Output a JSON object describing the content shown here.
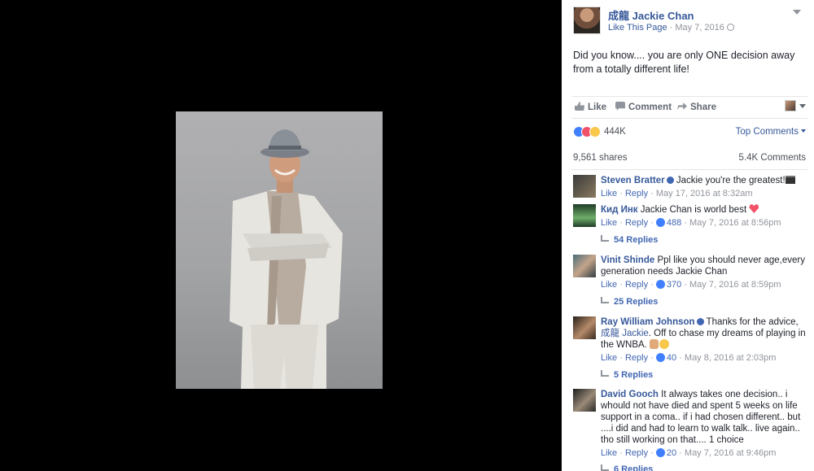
{
  "post": {
    "page_name": "成龍 Jackie Chan",
    "like_page": "Like This Page",
    "separator": " · ",
    "date": "May 7, 2016",
    "text": "Did you know.... you are only ONE decision away from a totally different life!"
  },
  "actions": {
    "like": "Like",
    "comment": "Comment",
    "share": "Share"
  },
  "reactions": {
    "count": "444K",
    "sort": "Top Comments"
  },
  "stats": {
    "shares": "9,561 shares",
    "comments": "5.4K Comments"
  },
  "comments": [
    {
      "author": "Steven Bratter",
      "verified": true,
      "text": " Jackie you're the greatest!",
      "like": "Like",
      "reply": "Reply",
      "likes": "",
      "time": "May 17, 2016 at 8:32am"
    },
    {
      "author": "Кид Инк",
      "text": " Jackie Chan is world best ",
      "like": "Like",
      "reply": "Reply",
      "likes": "488",
      "time": "May 7, 2016 at 8:56pm",
      "replies": "54 Replies"
    },
    {
      "author": "Vinit Shinde",
      "text": " Ppl like you should never age,every generation needs Jackie Chan",
      "like": "Like",
      "reply": "Reply",
      "likes": "370",
      "time": "May 7, 2016 at 8:59pm",
      "replies": "25 Replies"
    },
    {
      "author": "Ray William Johnson",
      "verified": true,
      "text_before": " Thanks for the advice, ",
      "mention": "成龍 Jackie",
      "text_after": ". Off to chase my dreams of playing in the WNBA. ",
      "like": "Like",
      "reply": "Reply",
      "likes": "40",
      "time": "May 8, 2016 at 2:03pm",
      "replies": "5 Replies"
    },
    {
      "author": "David Gooch",
      "text": " It always takes one decision.. i whould not have died and spent 5 weeks on life support in a coma.. if i had chosen different.. but ....i did and had to learn to walk talk.. live again.. tho still working on that.... 1 choice",
      "like": "Like",
      "reply": "Reply",
      "likes": "20",
      "time": "May 7, 2016 at 9:46pm",
      "replies": "6 Replies"
    }
  ],
  "meta_sep": " · "
}
